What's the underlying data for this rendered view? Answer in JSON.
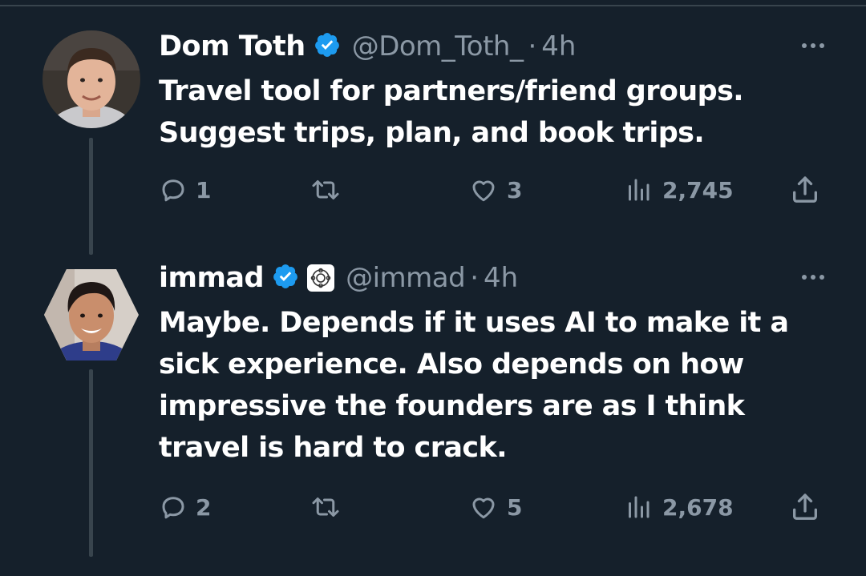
{
  "tweets": [
    {
      "display_name": "Dom Toth",
      "handle": "@Dom_Toth_",
      "separator": "·",
      "time": "4h",
      "text_lines": [
        "Travel tool for partners/friend groups.",
        "Suggest trips, plan, and book trips."
      ],
      "replies": "1",
      "retweets": "",
      "likes": "3",
      "views": "2,745",
      "verified": true,
      "affiliate_badge": false
    },
    {
      "display_name": "immad",
      "handle": "@immad",
      "separator": "·",
      "time": "4h",
      "text_lines": [
        "Maybe. Depends if it uses AI to make it a",
        "sick experience. Also depends on how",
        "impressive the founders are as I think",
        "travel is hard to crack."
      ],
      "replies": "2",
      "retweets": "",
      "likes": "5",
      "views": "2,678",
      "verified": true,
      "affiliate_badge": true
    }
  ],
  "colors": {
    "background": "#15202b",
    "text": "#ffffff",
    "secondary": "#8b98a5",
    "verified": "#1d9bf0",
    "divider": "#38444d"
  },
  "icons": [
    "reply-icon",
    "retweet-icon",
    "like-icon",
    "views-icon",
    "share-icon",
    "verified-badge-icon",
    "more-icon"
  ]
}
